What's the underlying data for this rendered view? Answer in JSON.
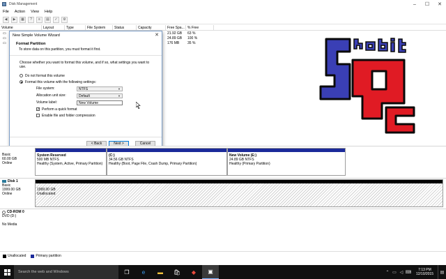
{
  "window": {
    "title": "Disk Management"
  },
  "menu": [
    "File",
    "Action",
    "View",
    "Help"
  ],
  "volume_list": {
    "columns": [
      "Volume",
      "Layout",
      "Type",
      "File System",
      "Status",
      "Capacity",
      "Free Spa...",
      "% Free"
    ],
    "rows": [
      {
        "free": "21.92 GB",
        "pct": "63 %"
      },
      {
        "free": "24.89 GB",
        "pct": "100 %"
      },
      {
        "free": "176 MB",
        "pct": "35 %"
      }
    ]
  },
  "wizard": {
    "title": "New Simple Volume Wizard",
    "header_title": "Format Partition",
    "header_sub": "To store data on this partition, you must format it first.",
    "intro": "Choose whether you want to format this volume, and if so, what settings you want to use.",
    "opt_no_format": "Do not format this volume",
    "opt_format": "Format this volume with the following settings:",
    "fs_label": "File system:",
    "fs_value": "NTFS",
    "alloc_label": "Allocation unit size:",
    "alloc_value": "Default",
    "vol_label": "Volume label:",
    "vol_value": "New Volume",
    "quick_format": "Perform a quick format",
    "compression": "Enable file and folder compression",
    "back": "< Back",
    "next": "Next >",
    "cancel": "Cancel"
  },
  "logo": {
    "letters_small": "hobit",
    "letters_big": "SP",
    "letters_c": "c"
  },
  "disks": {
    "disk0": {
      "type": "Basic",
      "size": "60.00 GB",
      "status": "Online",
      "parts": [
        {
          "name": "System Reserved",
          "size": "500 MB NTFS",
          "status": "Healthy (System, Active, Primary Partition)"
        },
        {
          "name": "(C:)",
          "size": "34.56 GB NTFS",
          "status": "Healthy (Boot, Page File, Crash Dump, Primary Partition)"
        },
        {
          "name": "New Volume  (E:)",
          "size": "24.89 GB NTFS",
          "status": "Healthy (Primary Partition)"
        }
      ]
    },
    "disk1": {
      "name": "Disk 1",
      "type": "Basic",
      "size": "1999.00 GB",
      "status": "Online",
      "part_size": "1999.00 GB",
      "part_status": "Unallocated"
    },
    "cdrom": {
      "name": "CD-ROM 0",
      "drive": "DVD (D:)",
      "status": "No Media"
    }
  },
  "legend": {
    "unallocated": "Unallocated",
    "primary": "Primary partition"
  },
  "taskbar": {
    "search_placeholder": "Search the web and Windows",
    "time": "7:13 PM",
    "date": "12/10/2015"
  },
  "colors": {
    "primary": "#1b2a9a",
    "logo_blue": "#3a3fb5",
    "logo_red": "#e01b24"
  }
}
